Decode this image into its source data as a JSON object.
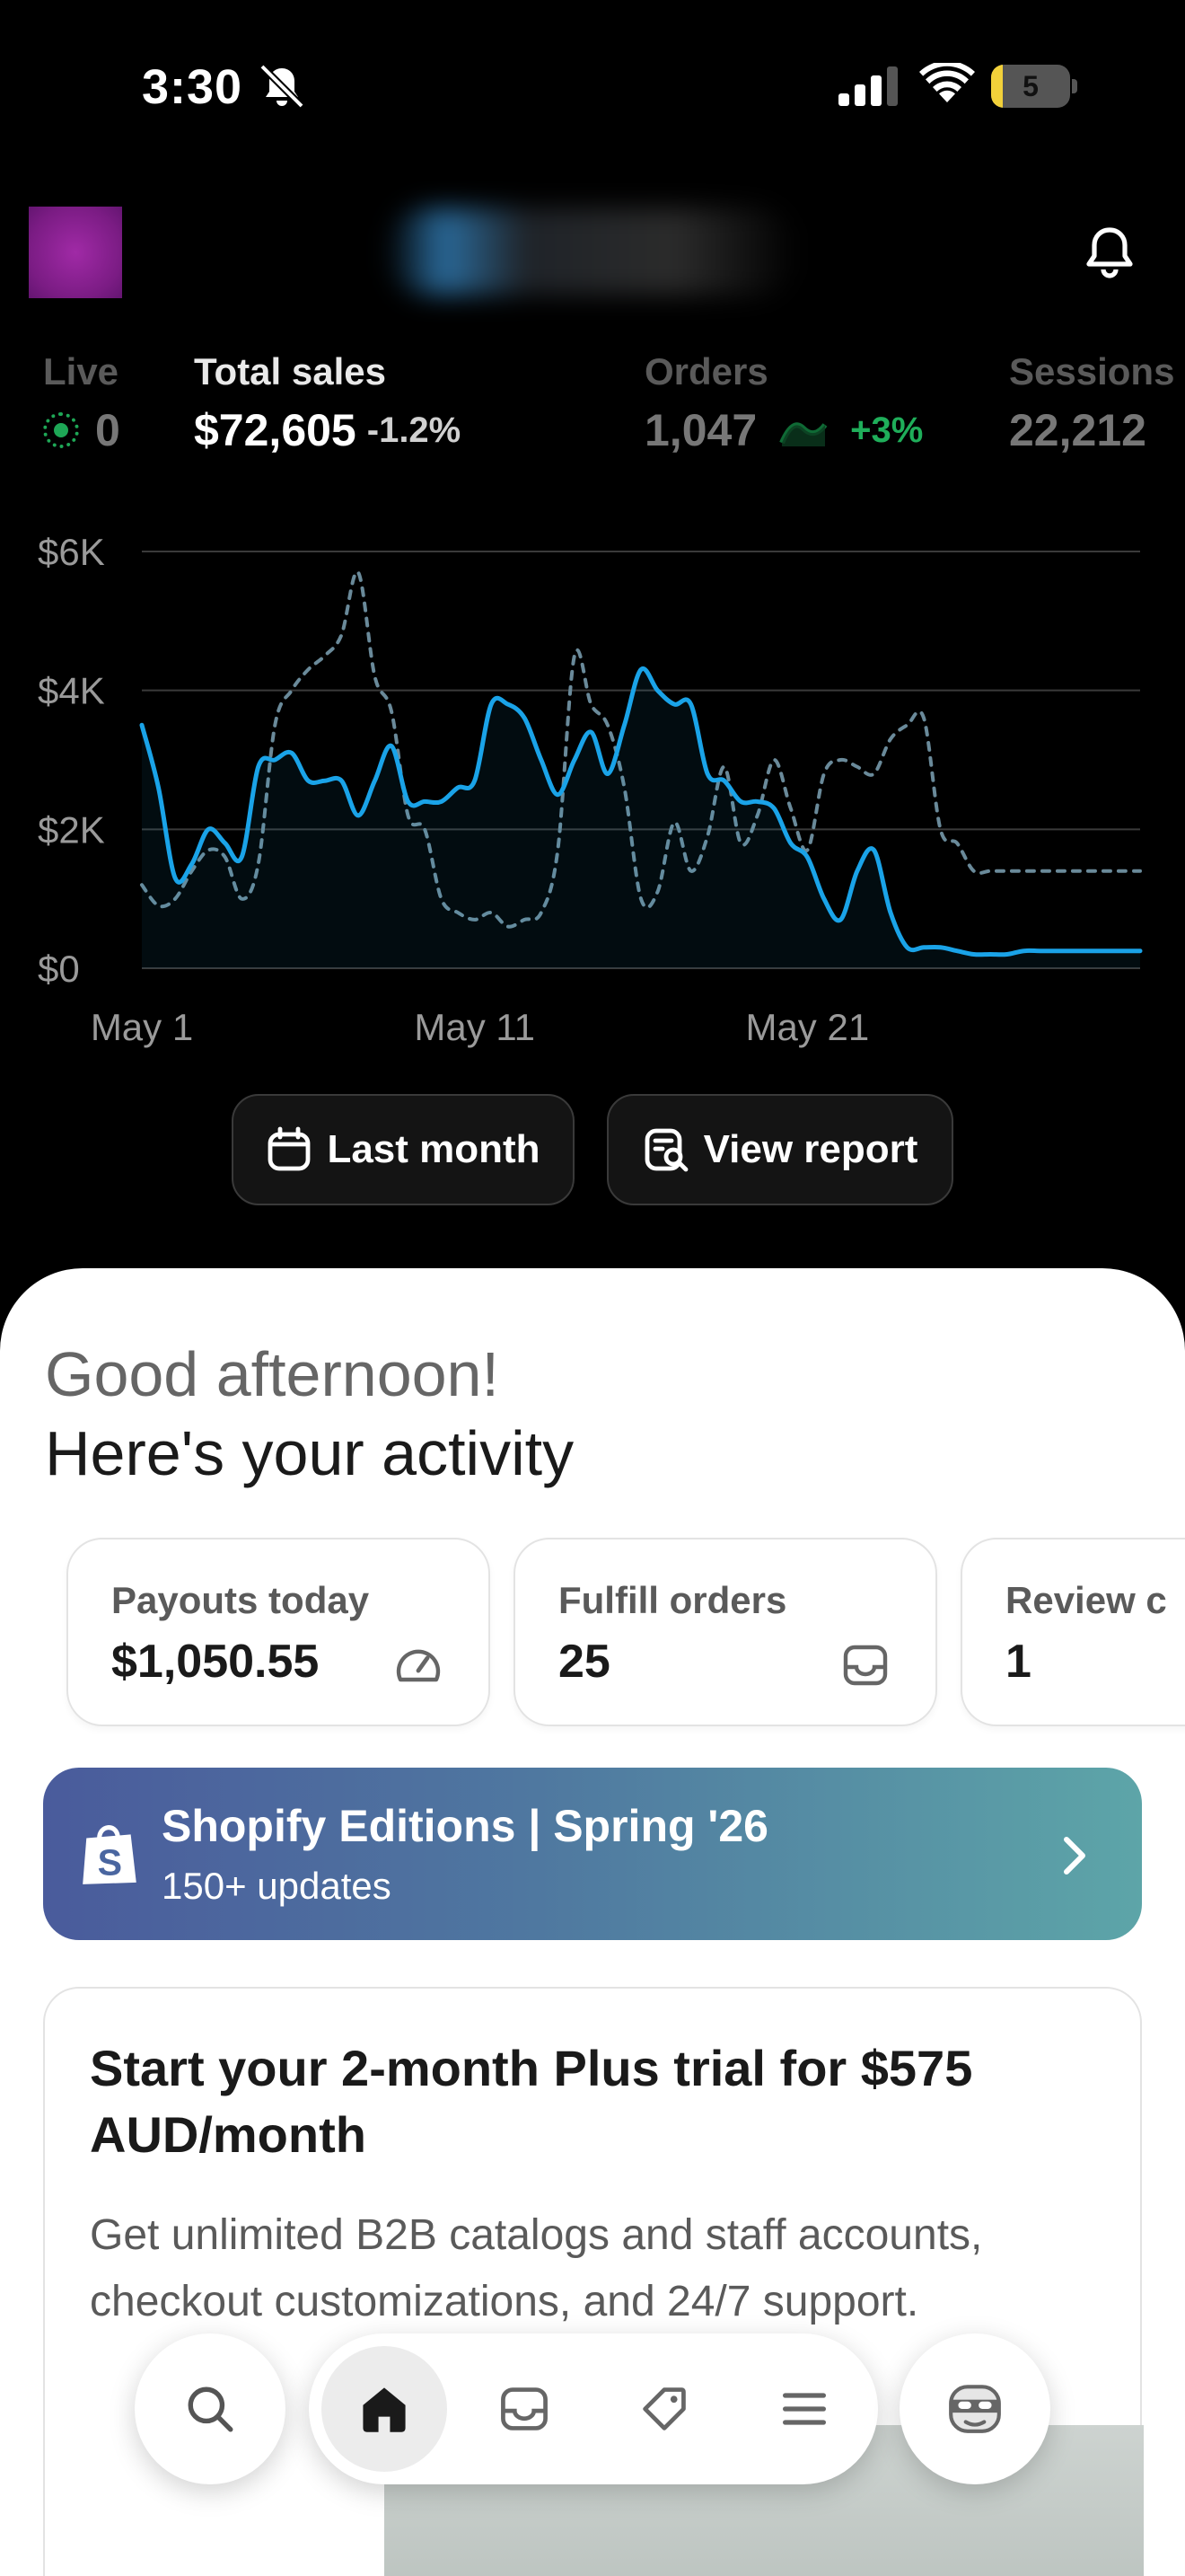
{
  "status_bar": {
    "time": "3:30",
    "battery_level": "5",
    "battery_fraction": 0.05
  },
  "header": {
    "notification_icon": "bell-icon"
  },
  "metrics": [
    {
      "label": "Live",
      "value": "0"
    },
    {
      "label": "Total sales",
      "value": "$72,605",
      "change": "-1.2%"
    },
    {
      "label": "Orders",
      "value": "1,047",
      "change": "+3%"
    },
    {
      "label": "Sessions",
      "value": "22,212"
    }
  ],
  "chart_data": {
    "type": "line",
    "y_ticks": [
      "$6K",
      "$4K",
      "$2K",
      "$0"
    ],
    "ylim": [
      0,
      6000
    ],
    "x_ticks": [
      {
        "label": "May 1",
        "day": 1
      },
      {
        "label": "May 11",
        "day": 11
      },
      {
        "label": "May 21",
        "day": 21
      }
    ],
    "xlim": [
      1,
      31
    ],
    "series": [
      {
        "style": "solid",
        "color": "#1aa3e8",
        "x": [
          1,
          1.5,
          2,
          2.5,
          3,
          3.5,
          4,
          4.5,
          5,
          5.5,
          6,
          6.5,
          7,
          7.5,
          8,
          8.5,
          9,
          9.5,
          10,
          10.5,
          11,
          11.5,
          12,
          12.5,
          13,
          13.5,
          14,
          14.5,
          15,
          15.5,
          16,
          16.5,
          17,
          17.5,
          18,
          18.5,
          19,
          19.5,
          20,
          20.5,
          21,
          21.5,
          22,
          22.5,
          23,
          23.5,
          24,
          24.5,
          25,
          25.5,
          26,
          26.5,
          27,
          27.5,
          28,
          28.5,
          29,
          29.5,
          30,
          30.5,
          31
        ],
        "values": [
          3500,
          2600,
          1300,
          1500,
          2000,
          1800,
          1600,
          2900,
          3000,
          3100,
          2700,
          2700,
          2700,
          2200,
          2700,
          3200,
          2400,
          2400,
          2400,
          2600,
          2700,
          3800,
          3800,
          3600,
          3000,
          2500,
          3000,
          3400,
          2800,
          3500,
          4300,
          4000,
          3800,
          3800,
          2800,
          2700,
          2400,
          2400,
          2300,
          1800,
          1600,
          1000,
          700,
          1400,
          1700,
          800,
          300,
          300,
          300,
          250,
          200,
          200,
          200,
          250,
          250,
          250,
          250,
          250,
          250,
          250,
          250
        ]
      },
      {
        "style": "dashed",
        "color": "#6a8a9a",
        "x": [
          1,
          1.5,
          2,
          2.5,
          3,
          3.5,
          4,
          4.5,
          5,
          5.5,
          6,
          6.5,
          7,
          7.5,
          8,
          8.5,
          9,
          9.5,
          10,
          10.5,
          11,
          11.5,
          12,
          12.5,
          13,
          13.5,
          14,
          14.5,
          15,
          15.5,
          16,
          16.5,
          17,
          17.5,
          18,
          18.5,
          19,
          19.5,
          20,
          20.5,
          21,
          21.5,
          22,
          22.5,
          23,
          23.5,
          24,
          24.5,
          25,
          25.5,
          26,
          26.5,
          27,
          27.5,
          28,
          28.5,
          29,
          29.5,
          30,
          30.5,
          31
        ],
        "values": [
          1200,
          900,
          1000,
          1400,
          1700,
          1600,
          1000,
          1500,
          3500,
          4000,
          4300,
          4500,
          4800,
          5700,
          4200,
          3700,
          2200,
          2000,
          1000,
          800,
          700,
          800,
          600,
          700,
          800,
          1700,
          4500,
          3800,
          3500,
          2600,
          1000,
          1100,
          2100,
          1400,
          1900,
          2900,
          1800,
          2200,
          3000,
          2300,
          1700,
          2800,
          3000,
          2900,
          2800,
          3300,
          3500,
          3600,
          2000,
          1800,
          1400,
          1400,
          1400,
          1400,
          1400,
          1400,
          1400,
          1400,
          1400,
          1400,
          1400
        ]
      }
    ]
  },
  "chart_actions": {
    "last_month": "Last month",
    "view_report": "View report"
  },
  "greeting": {
    "line1": "Good afternoon!",
    "line2": "Here's your activity"
  },
  "activity_cards": [
    {
      "label": "Payouts today",
      "value": "$1,050.55",
      "icon": "speedometer-icon"
    },
    {
      "label": "Fulfill orders",
      "value": "25",
      "icon": "inbox-icon"
    },
    {
      "label": "Review c",
      "value": "1"
    }
  ],
  "editions": {
    "title": "Shopify Editions | Spring '26",
    "subtitle": "150+ updates",
    "icon": "shopping-bag-icon"
  },
  "plus_trial": {
    "title": "Start your 2-month Plus trial  for $575 AUD/month",
    "body": "Get unlimited B2B catalogs and staff accounts, checkout customizations, and 24/7 support."
  },
  "bottom_nav": {
    "items": [
      "search-icon",
      "home-icon",
      "inbox-icon",
      "tag-icon",
      "menu-icon",
      "profile-icon"
    ],
    "active": "home-icon"
  }
}
